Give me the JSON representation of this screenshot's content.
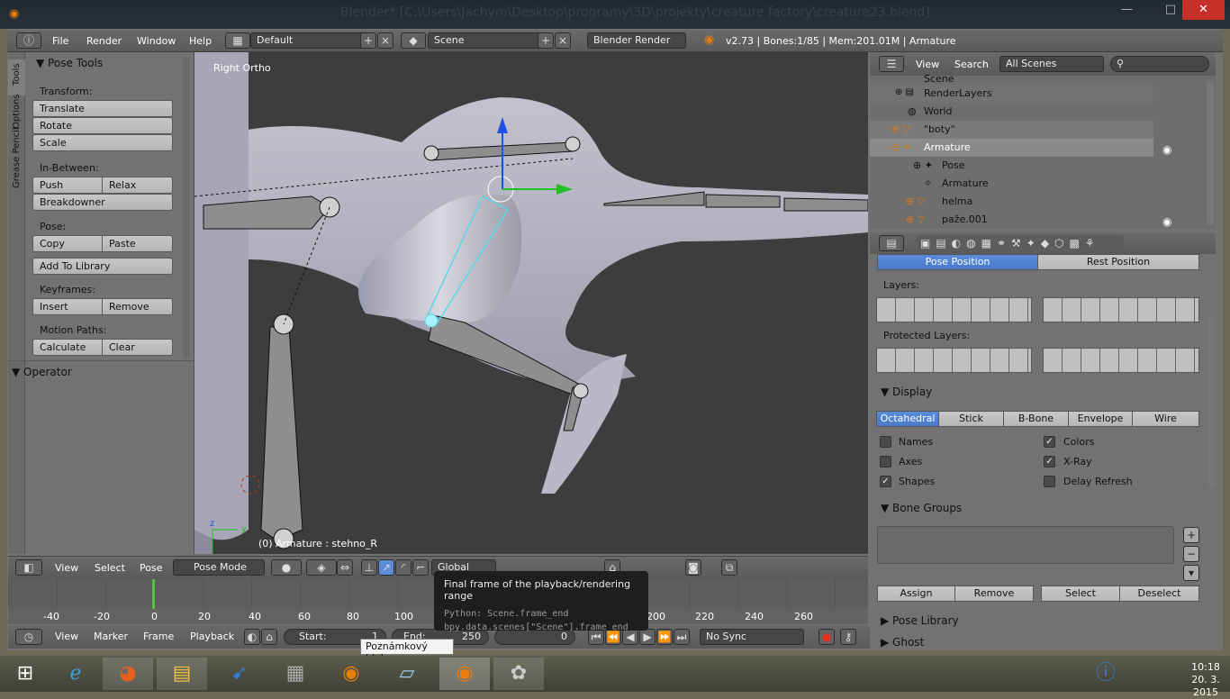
{
  "window": {
    "title": "Blender* [C:\\Users\\Jachym\\Desktop\\programy\\3D\\projekty\\creature factory\\creature23.blend]",
    "close": "✕",
    "minimize": "—",
    "maximize": "□"
  },
  "infobar": {
    "menus": [
      "File",
      "Render",
      "Window",
      "Help"
    ],
    "layout": "Default",
    "scene": "Scene",
    "engine": "Blender Render",
    "stats": "v2.73 | Bones:1/85 | Mem:201.01M | Armature"
  },
  "tabs": {
    "tools": "Tools",
    "options": "Options",
    "grease": "Grease Pencil"
  },
  "toolshelf": {
    "title": "Pose Tools",
    "transform_label": "Transform:",
    "translate": "Translate",
    "rotate": "Rotate",
    "scale": "Scale",
    "inbetween_label": "In-Between:",
    "push": "Push",
    "relax": "Relax",
    "breakdowner": "Breakdowner",
    "pose_label": "Pose:",
    "copy": "Copy",
    "paste": "Paste",
    "add_library": "Add To Library",
    "keyframes_label": "Keyframes:",
    "insert": "Insert",
    "remove": "Remove",
    "motion_label": "Motion Paths:",
    "calculate": "Calculate",
    "clear": "Clear",
    "operator": "Operator"
  },
  "viewport": {
    "view_name": "Right Ortho",
    "object_info": "(0) Armature : stehno_R",
    "axis_y": "y",
    "axis_z": "z"
  },
  "vpheader": {
    "view": "View",
    "select": "Select",
    "pose": "Pose",
    "mode": "Pose Mode",
    "orientation": "Global"
  },
  "timeline": {
    "ticks": [
      "-40",
      "-20",
      "0",
      "20",
      "40",
      "60",
      "80",
      "100",
      "200",
      "220",
      "240",
      "260"
    ],
    "view": "View",
    "marker": "Marker",
    "frame": "Frame",
    "playback": "Playback",
    "start_label": "Start:",
    "start_value": "1",
    "end_label": "End:",
    "end_value": "250",
    "current": "0",
    "sync": "No Sync"
  },
  "tooltip": {
    "title": "Final frame of the playback/rendering range",
    "python": "Python: Scene.frame_end",
    "data": "bpy.data.scenes[\"Scene\"].frame_end"
  },
  "win_tooltip": "Poznámkový blok",
  "outliner": {
    "view": "View",
    "search": "Search",
    "filter": "All Scenes",
    "scene": "Scene",
    "items": [
      "RenderLayers",
      "World",
      "\"boty\"",
      "Armature",
      "Pose",
      "Armature",
      "helma",
      "paže.001"
    ]
  },
  "props": {
    "pose_position": "Pose Position",
    "rest_position": "Rest Position",
    "layers": "Layers:",
    "protected_layers": "Protected Layers:",
    "display": "Display",
    "display_modes": [
      "Octahedral",
      "Stick",
      "B-Bone",
      "Envelope",
      "Wire"
    ],
    "names": "Names",
    "axes": "Axes",
    "shapes": "Shapes",
    "colors": "Colors",
    "xray": "X-Ray",
    "delay": "Delay Refresh",
    "bone_groups": "Bone Groups",
    "assign": "Assign",
    "remove": "Remove",
    "select": "Select",
    "deselect": "Deselect",
    "pose_library": "Pose Library",
    "ghost": "Ghost",
    "check": "✓"
  },
  "taskbar": {
    "time": "10:18",
    "date": "20. 3. 2015"
  }
}
